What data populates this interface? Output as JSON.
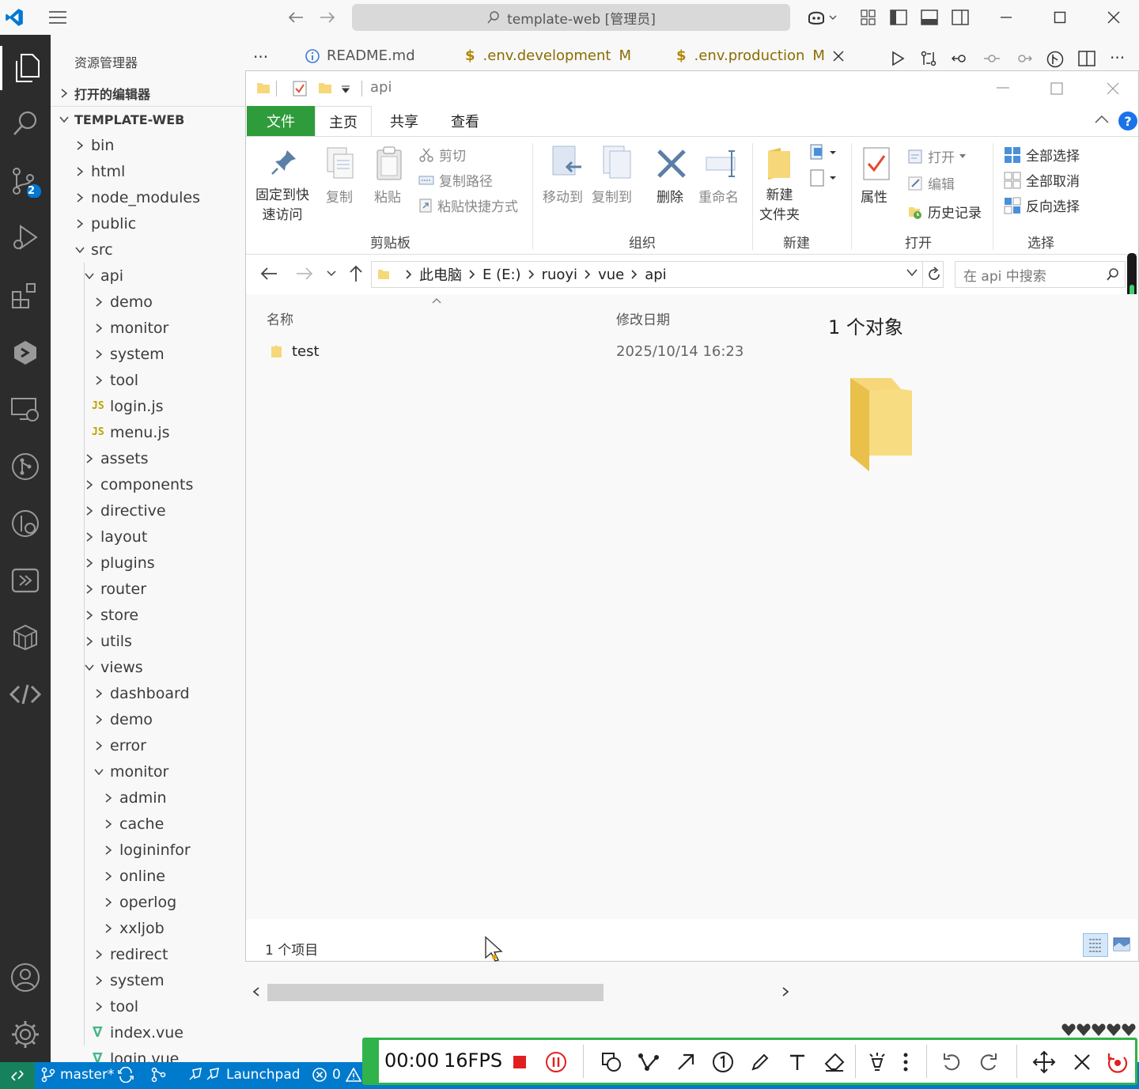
{
  "titlebar": {
    "search_text": "template-web [管理员]"
  },
  "activity": {
    "scm_badge": "2"
  },
  "sidebar": {
    "header": "资源管理器",
    "more": "···",
    "open_editors": "打开的编辑器",
    "workspace": "TEMPLATE-WEB",
    "tree": [
      {
        "label": "bin"
      },
      {
        "label": "html"
      },
      {
        "label": "node_modules"
      },
      {
        "label": "public"
      },
      {
        "label": "src"
      },
      {
        "label": "api"
      },
      {
        "label": "demo"
      },
      {
        "label": "monitor"
      },
      {
        "label": "system"
      },
      {
        "label": "tool"
      },
      {
        "label": "login.js"
      },
      {
        "label": "menu.js"
      },
      {
        "label": "assets"
      },
      {
        "label": "components"
      },
      {
        "label": "directive"
      },
      {
        "label": "layout"
      },
      {
        "label": "plugins"
      },
      {
        "label": "router"
      },
      {
        "label": "store"
      },
      {
        "label": "utils"
      },
      {
        "label": "views"
      },
      {
        "label": "dashboard"
      },
      {
        "label": "demo"
      },
      {
        "label": "error"
      },
      {
        "label": "monitor"
      },
      {
        "label": "admin"
      },
      {
        "label": "cache"
      },
      {
        "label": "logininfor"
      },
      {
        "label": "online"
      },
      {
        "label": "operlog"
      },
      {
        "label": "xxljob"
      },
      {
        "label": "redirect"
      },
      {
        "label": "system"
      },
      {
        "label": "tool"
      },
      {
        "label": "index.vue"
      },
      {
        "label": "login.vue"
      }
    ],
    "js_tag": "JS"
  },
  "tabs": [
    {
      "label": "README.md",
      "status": ""
    },
    {
      "label": ".env.development",
      "status": "M"
    },
    {
      "label": ".env.production",
      "status": "M"
    }
  ],
  "explorer": {
    "title": "api",
    "ribbon_tabs": [
      "文件",
      "主页",
      "共享",
      "查看"
    ],
    "clipboard": {
      "pin_line1": "固定到快",
      "pin_line2": "速访问",
      "copy": "复制",
      "paste": "粘贴",
      "cut": "剪切",
      "copy_path": "复制路径",
      "paste_shortcut": "粘贴快捷方式",
      "group": "剪贴板"
    },
    "organize": {
      "move_to": "移动到",
      "copy_to": "复制到",
      "delete": "删除",
      "rename": "重命名",
      "group": "组织"
    },
    "new": {
      "folder_line1": "新建",
      "folder_line2": "文件夹",
      "group": "新建"
    },
    "open": {
      "properties": "属性",
      "open": "打开",
      "edit": "编辑",
      "history": "历史记录",
      "group": "打开"
    },
    "select": {
      "select_all": "全部选择",
      "select_none": "全部取消",
      "invert": "反向选择",
      "group": "选择"
    },
    "breadcrumb": [
      "此电脑",
      "E (E:)",
      "ruoyi",
      "vue",
      "api"
    ],
    "search_placeholder": "在 api 中搜索",
    "columns": {
      "name": "名称",
      "modified": "修改日期"
    },
    "files": [
      {
        "name": "test",
        "modified": "2025/10/14 16:23"
      }
    ],
    "preview_title": "1 个对象",
    "item_count": "1 个项目"
  },
  "statusbar": {
    "branch": "master*",
    "launchpad": "Launchpad",
    "errors": "0"
  },
  "recorder": {
    "time": "00:00",
    "fps": "16FPS"
  },
  "colors": {
    "accent_blue": "#007acc",
    "ribbon_file_green": "#2e9c3a",
    "recorder_green": "#2fb34a",
    "folder_yellow": "#f6d77a"
  }
}
